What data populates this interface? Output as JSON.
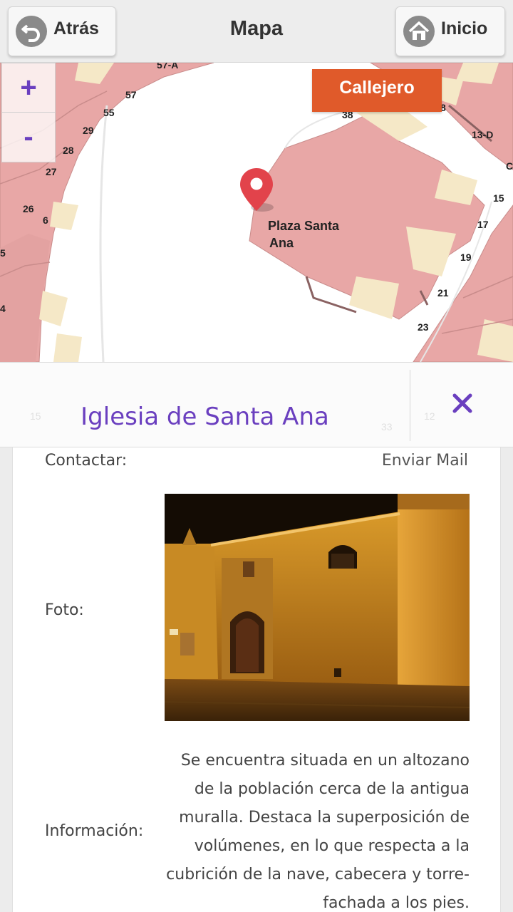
{
  "header": {
    "back_label": "Atrás",
    "title": "Mapa",
    "home_label": "Inicio"
  },
  "map": {
    "zoom_in": "+",
    "zoom_out": "-",
    "callejero_label": "Callejero",
    "place_label_line1": "Plaza Santa",
    "place_label_line2": "Ana",
    "house_numbers": [
      "57-A",
      "57",
      "55",
      "29",
      "28",
      "27",
      "26",
      "6",
      "5",
      "4",
      "38",
      "8",
      "13-D",
      "C",
      "15",
      "17",
      "19",
      "21",
      "23"
    ],
    "faded_numbers": [
      "15",
      "12",
      "33"
    ],
    "colors": {
      "building": "#e8a7a6",
      "courtyard": "#f5e8c7",
      "road": "#ffffff",
      "marker": "#e2434b"
    }
  },
  "panel": {
    "name": "Iglesia de Santa Ana",
    "close_icon": "close-x-icon",
    "contact_label": "Contactar:",
    "contact_link": "Enviar Mail",
    "photo_label": "Foto:",
    "info_label": "Información:",
    "info_lines": [
      "Se encuentra situada en un altozano",
      "de la población cerca de la antigua",
      "muralla. Destaca la superposición de",
      "volúmenes, en lo que respecta a la",
      "cubrición de la nave, cabecera y torre-",
      "fachada a los pies."
    ],
    "accent_color": "#6a3fbf"
  }
}
